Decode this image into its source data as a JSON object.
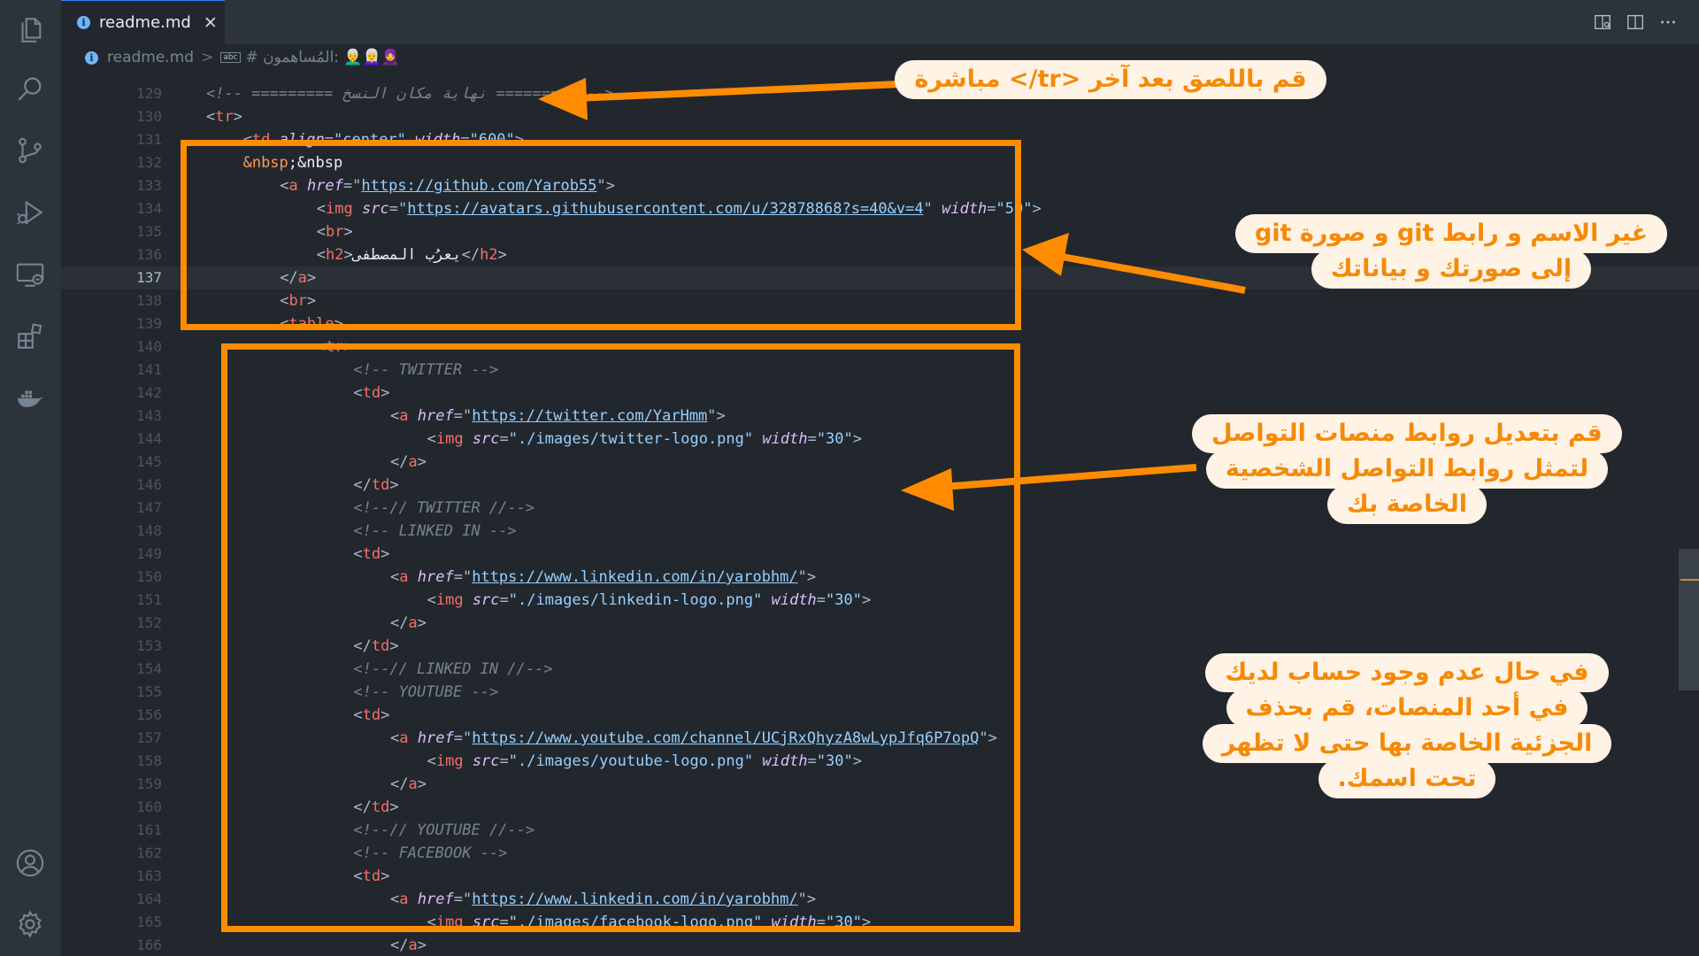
{
  "tab": {
    "filename": "readme.md",
    "info_icon": "i",
    "close_glyph": "✕"
  },
  "breadcrumb": {
    "file": "readme.md",
    "separator": ">",
    "symbol_icon": "abc",
    "heading": "# المُساهمون: 👨‍🦳👩‍🦳🧕"
  },
  "code": {
    "current_line": 137,
    "lines": [
      {
        "n": 129,
        "indent": 1,
        "tokens": [
          [
            "comment",
            "<!-- ========= نهاية مكان النسخ ========= -->"
          ]
        ]
      },
      {
        "n": 130,
        "indent": 1,
        "tokens": [
          [
            "bracket",
            "<"
          ],
          [
            "tag",
            "tr"
          ],
          [
            "bracket",
            ">"
          ]
        ]
      },
      {
        "n": 131,
        "indent": 2,
        "tokens": [
          [
            "bracket",
            "<"
          ],
          [
            "tag",
            "td"
          ],
          [
            "text",
            " "
          ],
          [
            "attr",
            "align"
          ],
          [
            "bracket",
            "="
          ],
          [
            "val",
            "\"center\""
          ],
          [
            "text",
            " "
          ],
          [
            "attr",
            "width"
          ],
          [
            "bracket",
            "="
          ],
          [
            "val",
            "\"600\""
          ],
          [
            "bracket",
            ">"
          ]
        ]
      },
      {
        "n": 132,
        "indent": 2,
        "tokens": [
          [
            "ent",
            "&nbsp"
          ],
          [
            "text",
            ";&nbsp"
          ]
        ]
      },
      {
        "n": 133,
        "indent": 3,
        "tokens": [
          [
            "bracket",
            "<"
          ],
          [
            "tag",
            "a"
          ],
          [
            "text",
            " "
          ],
          [
            "attr",
            "href"
          ],
          [
            "bracket",
            "=\""
          ],
          [
            "url",
            "https://github.com/Yarob55"
          ],
          [
            "bracket",
            "\">"
          ]
        ]
      },
      {
        "n": 134,
        "indent": 4,
        "tokens": [
          [
            "bracket",
            "<"
          ],
          [
            "tag",
            "img"
          ],
          [
            "text",
            " "
          ],
          [
            "attr",
            "src"
          ],
          [
            "bracket",
            "=\""
          ],
          [
            "url",
            "https://avatars.githubusercontent.com/u/32878868?s=40&v=4"
          ],
          [
            "bracket",
            "\""
          ],
          [
            "text",
            " "
          ],
          [
            "attr",
            "width"
          ],
          [
            "bracket",
            "="
          ],
          [
            "val",
            "\"50\""
          ],
          [
            "bracket",
            ">"
          ]
        ]
      },
      {
        "n": 135,
        "indent": 4,
        "tokens": [
          [
            "bracket",
            "<"
          ],
          [
            "tag",
            "br"
          ],
          [
            "bracket",
            ">"
          ]
        ]
      },
      {
        "n": 136,
        "indent": 4,
        "tokens": [
          [
            "bracket",
            "<"
          ],
          [
            "tag",
            "h2"
          ],
          [
            "bracket",
            ">"
          ],
          [
            "text",
            "يعرُب المصطفى"
          ],
          [
            "bracket",
            "</"
          ],
          [
            "tag",
            "h2"
          ],
          [
            "bracket",
            ">"
          ]
        ]
      },
      {
        "n": 137,
        "indent": 3,
        "tokens": [
          [
            "bracket",
            "</"
          ],
          [
            "tag",
            "a"
          ],
          [
            "bracket",
            ">"
          ]
        ]
      },
      {
        "n": 138,
        "indent": 3,
        "tokens": [
          [
            "bracket",
            "<"
          ],
          [
            "tag",
            "br"
          ],
          [
            "bracket",
            ">"
          ]
        ]
      },
      {
        "n": 139,
        "indent": 3,
        "tokens": [
          [
            "bracket",
            "<"
          ],
          [
            "tag",
            "table"
          ],
          [
            "bracket",
            ">"
          ]
        ]
      },
      {
        "n": 140,
        "indent": 4,
        "tokens": [
          [
            "bracket",
            "<"
          ],
          [
            "tag",
            "tr"
          ],
          [
            "bracket",
            ">"
          ]
        ]
      },
      {
        "n": 141,
        "indent": 5,
        "tokens": [
          [
            "comment",
            "<!-- TWITTER -->"
          ]
        ]
      },
      {
        "n": 142,
        "indent": 5,
        "tokens": [
          [
            "bracket",
            "<"
          ],
          [
            "tag",
            "td"
          ],
          [
            "bracket",
            ">"
          ]
        ]
      },
      {
        "n": 143,
        "indent": 6,
        "tokens": [
          [
            "bracket",
            "<"
          ],
          [
            "tag",
            "a"
          ],
          [
            "text",
            " "
          ],
          [
            "attr",
            "href"
          ],
          [
            "bracket",
            "=\""
          ],
          [
            "url",
            "https://twitter.com/YarHmm"
          ],
          [
            "bracket",
            "\">"
          ]
        ]
      },
      {
        "n": 144,
        "indent": 7,
        "tokens": [
          [
            "bracket",
            "<"
          ],
          [
            "tag",
            "img"
          ],
          [
            "text",
            " "
          ],
          [
            "attr",
            "src"
          ],
          [
            "bracket",
            "="
          ],
          [
            "val",
            "\"./images/twitter-logo.png\""
          ],
          [
            "text",
            " "
          ],
          [
            "attr",
            "width"
          ],
          [
            "bracket",
            "="
          ],
          [
            "val",
            "\"30\""
          ],
          [
            "bracket",
            ">"
          ]
        ]
      },
      {
        "n": 145,
        "indent": 6,
        "tokens": [
          [
            "bracket",
            "</"
          ],
          [
            "tag",
            "a"
          ],
          [
            "bracket",
            ">"
          ]
        ]
      },
      {
        "n": 146,
        "indent": 5,
        "tokens": [
          [
            "bracket",
            "</"
          ],
          [
            "tag",
            "td"
          ],
          [
            "bracket",
            ">"
          ]
        ]
      },
      {
        "n": 147,
        "indent": 5,
        "tokens": [
          [
            "comment",
            "<!--// TWITTER //-->"
          ]
        ]
      },
      {
        "n": 148,
        "indent": 5,
        "tokens": [
          [
            "comment",
            "<!-- LINKED IN -->"
          ]
        ]
      },
      {
        "n": 149,
        "indent": 5,
        "tokens": [
          [
            "bracket",
            "<"
          ],
          [
            "tag",
            "td"
          ],
          [
            "bracket",
            ">"
          ]
        ]
      },
      {
        "n": 150,
        "indent": 6,
        "tokens": [
          [
            "bracket",
            "<"
          ],
          [
            "tag",
            "a"
          ],
          [
            "text",
            " "
          ],
          [
            "attr",
            "href"
          ],
          [
            "bracket",
            "=\""
          ],
          [
            "url",
            "https://www.linkedin.com/in/yarobhm/"
          ],
          [
            "bracket",
            "\">"
          ]
        ]
      },
      {
        "n": 151,
        "indent": 7,
        "tokens": [
          [
            "bracket",
            "<"
          ],
          [
            "tag",
            "img"
          ],
          [
            "text",
            " "
          ],
          [
            "attr",
            "src"
          ],
          [
            "bracket",
            "="
          ],
          [
            "val",
            "\"./images/linkedin-logo.png\""
          ],
          [
            "text",
            " "
          ],
          [
            "attr",
            "width"
          ],
          [
            "bracket",
            "="
          ],
          [
            "val",
            "\"30\""
          ],
          [
            "bracket",
            ">"
          ]
        ]
      },
      {
        "n": 152,
        "indent": 6,
        "tokens": [
          [
            "bracket",
            "</"
          ],
          [
            "tag",
            "a"
          ],
          [
            "bracket",
            ">"
          ]
        ]
      },
      {
        "n": 153,
        "indent": 5,
        "tokens": [
          [
            "bracket",
            "</"
          ],
          [
            "tag",
            "td"
          ],
          [
            "bracket",
            ">"
          ]
        ]
      },
      {
        "n": 154,
        "indent": 5,
        "tokens": [
          [
            "comment",
            "<!--// LINKED IN //-->"
          ]
        ]
      },
      {
        "n": 155,
        "indent": 5,
        "tokens": [
          [
            "comment",
            "<!-- YOUTUBE -->"
          ]
        ]
      },
      {
        "n": 156,
        "indent": 5,
        "tokens": [
          [
            "bracket",
            "<"
          ],
          [
            "tag",
            "td"
          ],
          [
            "bracket",
            ">"
          ]
        ]
      },
      {
        "n": 157,
        "indent": 6,
        "tokens": [
          [
            "bracket",
            "<"
          ],
          [
            "tag",
            "a"
          ],
          [
            "text",
            " "
          ],
          [
            "attr",
            "href"
          ],
          [
            "bracket",
            "=\""
          ],
          [
            "url",
            "https://www.youtube.com/channel/UCjRxQhyzA8wLypJfq6P7opQ"
          ],
          [
            "bracket",
            "\">"
          ]
        ]
      },
      {
        "n": 158,
        "indent": 7,
        "tokens": [
          [
            "bracket",
            "<"
          ],
          [
            "tag",
            "img"
          ],
          [
            "text",
            " "
          ],
          [
            "attr",
            "src"
          ],
          [
            "bracket",
            "="
          ],
          [
            "val",
            "\"./images/youtube-logo.png\""
          ],
          [
            "text",
            " "
          ],
          [
            "attr",
            "width"
          ],
          [
            "bracket",
            "="
          ],
          [
            "val",
            "\"30\""
          ],
          [
            "bracket",
            ">"
          ]
        ]
      },
      {
        "n": 159,
        "indent": 6,
        "tokens": [
          [
            "bracket",
            "</"
          ],
          [
            "tag",
            "a"
          ],
          [
            "bracket",
            ">"
          ]
        ]
      },
      {
        "n": 160,
        "indent": 5,
        "tokens": [
          [
            "bracket",
            "</"
          ],
          [
            "tag",
            "td"
          ],
          [
            "bracket",
            ">"
          ]
        ]
      },
      {
        "n": 161,
        "indent": 5,
        "tokens": [
          [
            "comment",
            "<!--// YOUTUBE //-->"
          ]
        ]
      },
      {
        "n": 162,
        "indent": 5,
        "tokens": [
          [
            "comment",
            "<!-- FACEBOOK -->"
          ]
        ]
      },
      {
        "n": 163,
        "indent": 5,
        "tokens": [
          [
            "bracket",
            "<"
          ],
          [
            "tag",
            "td"
          ],
          [
            "bracket",
            ">"
          ]
        ]
      },
      {
        "n": 164,
        "indent": 6,
        "tokens": [
          [
            "bracket",
            "<"
          ],
          [
            "tag",
            "a"
          ],
          [
            "text",
            " "
          ],
          [
            "attr",
            "href"
          ],
          [
            "bracket",
            "=\""
          ],
          [
            "url",
            "https://www.linkedin.com/in/yarobhm/"
          ],
          [
            "bracket",
            "\">"
          ]
        ]
      },
      {
        "n": 165,
        "indent": 7,
        "tokens": [
          [
            "bracket",
            "<"
          ],
          [
            "tag",
            "img"
          ],
          [
            "text",
            " "
          ],
          [
            "attr",
            "src"
          ],
          [
            "bracket",
            "="
          ],
          [
            "val",
            "\"./images/facebook-logo.png\""
          ],
          [
            "text",
            " "
          ],
          [
            "attr",
            "width"
          ],
          [
            "bracket",
            "="
          ],
          [
            "val",
            "\"30\""
          ],
          [
            "bracket",
            ">"
          ]
        ]
      },
      {
        "n": 166,
        "indent": 6,
        "tokens": [
          [
            "bracket",
            "</"
          ],
          [
            "tag",
            "a"
          ],
          [
            "bracket",
            ">"
          ]
        ]
      }
    ]
  },
  "callouts": {
    "c1": {
      "lines": [
        "قم باللصق بعد آخر <tr/> مباشرة"
      ]
    },
    "c2": {
      "lines": [
        "غير الاسم و رابط git و صورة git",
        "إلى صورتك و بياناتك"
      ]
    },
    "c3": {
      "lines": [
        "قم بتعديل روابط منصات التواصل",
        "لتمثل روابط التواصل الشخصية",
        "الخاصة بك"
      ]
    },
    "c4": {
      "lines": [
        "في حال عدم وجود حساب لديك",
        "في أحد المنصات، قم بحذف",
        "الجزئية الخاصة بها حتى لا تظهر",
        "تحت اسمك."
      ]
    }
  },
  "colors": {
    "annotation": "#ff8c00",
    "callout_bg": "#fff3e6",
    "callout_text": "#f58a07",
    "editor_bg": "#22272e",
    "sidebar_bg": "#2d333b"
  },
  "icons": [
    "explorer-icon",
    "search-icon",
    "source-control-icon",
    "run-debug-icon",
    "remote-explorer-icon",
    "extensions-icon",
    "docker-icon",
    "account-icon",
    "settings-gear-icon",
    "preview-icon",
    "split-editor-icon",
    "more-actions-icon"
  ]
}
